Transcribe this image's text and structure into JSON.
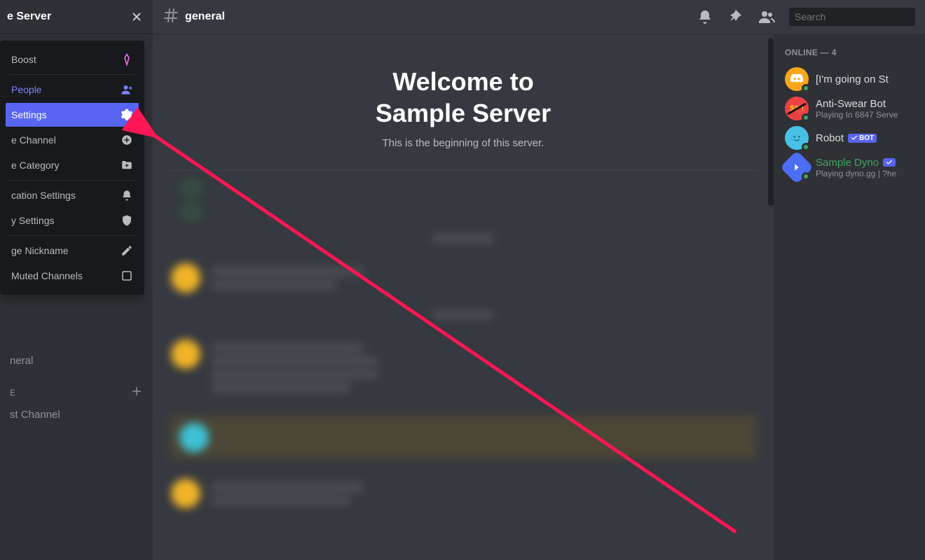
{
  "sidebar": {
    "server_name": "e Server",
    "menu": {
      "boost": "Boost",
      "people": "People",
      "settings": "Settings",
      "channel": "e Channel",
      "category": "e Category",
      "notifications": "cation Settings",
      "privacy": "y Settings",
      "nickname": "ge Nickname",
      "muted": "Muted Channels"
    },
    "channels": {
      "general_label": "neral",
      "voice_cat": "E",
      "voice_channel": "st Channel"
    }
  },
  "topbar": {
    "channel": "general",
    "search_placeholder": "Search"
  },
  "main": {
    "welcome_line1": "Welcome to",
    "welcome_line2": "Sample Server",
    "welcome_sub": "This is the beginning of this server."
  },
  "members": {
    "header": "ONLINE — 4",
    "list": [
      {
        "name": "[I'm going on St",
        "sub": ""
      },
      {
        "name": "Anti-Swear Bot",
        "sub": "Playing In 6847 Serve"
      },
      {
        "name": "Robot",
        "sub": ""
      },
      {
        "name": "Sample Dyno",
        "sub": "Playing dyno.gg | ?he"
      }
    ],
    "bot_label": "BOT"
  }
}
